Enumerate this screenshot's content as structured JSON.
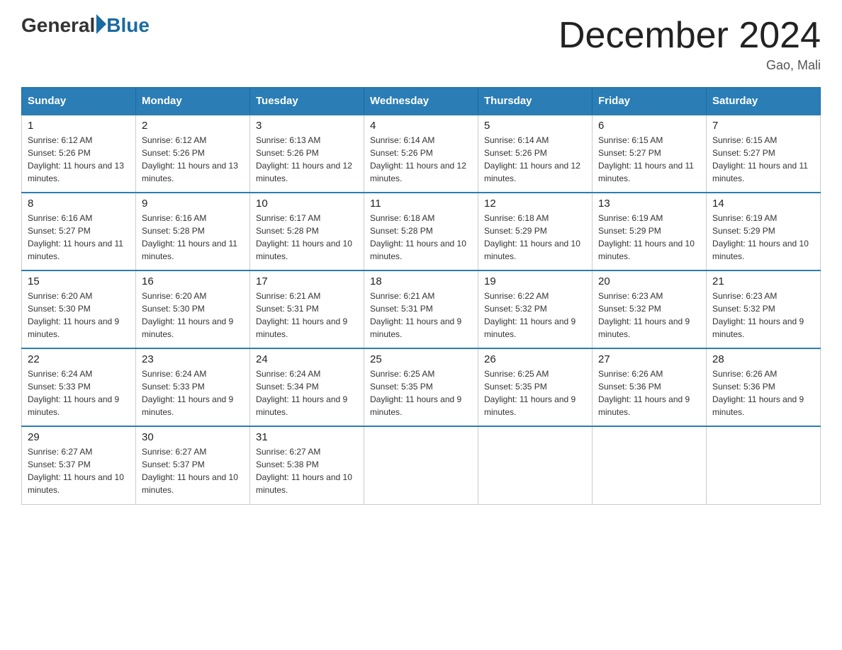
{
  "header": {
    "logo_general": "General",
    "logo_blue": "Blue",
    "title": "December 2024",
    "location": "Gao, Mali"
  },
  "days_of_week": [
    "Sunday",
    "Monday",
    "Tuesday",
    "Wednesday",
    "Thursday",
    "Friday",
    "Saturday"
  ],
  "weeks": [
    [
      {
        "day": "1",
        "sunrise": "6:12 AM",
        "sunset": "5:26 PM",
        "daylight": "11 hours and 13 minutes."
      },
      {
        "day": "2",
        "sunrise": "6:12 AM",
        "sunset": "5:26 PM",
        "daylight": "11 hours and 13 minutes."
      },
      {
        "day": "3",
        "sunrise": "6:13 AM",
        "sunset": "5:26 PM",
        "daylight": "11 hours and 12 minutes."
      },
      {
        "day": "4",
        "sunrise": "6:14 AM",
        "sunset": "5:26 PM",
        "daylight": "11 hours and 12 minutes."
      },
      {
        "day": "5",
        "sunrise": "6:14 AM",
        "sunset": "5:26 PM",
        "daylight": "11 hours and 12 minutes."
      },
      {
        "day": "6",
        "sunrise": "6:15 AM",
        "sunset": "5:27 PM",
        "daylight": "11 hours and 11 minutes."
      },
      {
        "day": "7",
        "sunrise": "6:15 AM",
        "sunset": "5:27 PM",
        "daylight": "11 hours and 11 minutes."
      }
    ],
    [
      {
        "day": "8",
        "sunrise": "6:16 AM",
        "sunset": "5:27 PM",
        "daylight": "11 hours and 11 minutes."
      },
      {
        "day": "9",
        "sunrise": "6:16 AM",
        "sunset": "5:28 PM",
        "daylight": "11 hours and 11 minutes."
      },
      {
        "day": "10",
        "sunrise": "6:17 AM",
        "sunset": "5:28 PM",
        "daylight": "11 hours and 10 minutes."
      },
      {
        "day": "11",
        "sunrise": "6:18 AM",
        "sunset": "5:28 PM",
        "daylight": "11 hours and 10 minutes."
      },
      {
        "day": "12",
        "sunrise": "6:18 AM",
        "sunset": "5:29 PM",
        "daylight": "11 hours and 10 minutes."
      },
      {
        "day": "13",
        "sunrise": "6:19 AM",
        "sunset": "5:29 PM",
        "daylight": "11 hours and 10 minutes."
      },
      {
        "day": "14",
        "sunrise": "6:19 AM",
        "sunset": "5:29 PM",
        "daylight": "11 hours and 10 minutes."
      }
    ],
    [
      {
        "day": "15",
        "sunrise": "6:20 AM",
        "sunset": "5:30 PM",
        "daylight": "11 hours and 9 minutes."
      },
      {
        "day": "16",
        "sunrise": "6:20 AM",
        "sunset": "5:30 PM",
        "daylight": "11 hours and 9 minutes."
      },
      {
        "day": "17",
        "sunrise": "6:21 AM",
        "sunset": "5:31 PM",
        "daylight": "11 hours and 9 minutes."
      },
      {
        "day": "18",
        "sunrise": "6:21 AM",
        "sunset": "5:31 PM",
        "daylight": "11 hours and 9 minutes."
      },
      {
        "day": "19",
        "sunrise": "6:22 AM",
        "sunset": "5:32 PM",
        "daylight": "11 hours and 9 minutes."
      },
      {
        "day": "20",
        "sunrise": "6:23 AM",
        "sunset": "5:32 PM",
        "daylight": "11 hours and 9 minutes."
      },
      {
        "day": "21",
        "sunrise": "6:23 AM",
        "sunset": "5:32 PM",
        "daylight": "11 hours and 9 minutes."
      }
    ],
    [
      {
        "day": "22",
        "sunrise": "6:24 AM",
        "sunset": "5:33 PM",
        "daylight": "11 hours and 9 minutes."
      },
      {
        "day": "23",
        "sunrise": "6:24 AM",
        "sunset": "5:33 PM",
        "daylight": "11 hours and 9 minutes."
      },
      {
        "day": "24",
        "sunrise": "6:24 AM",
        "sunset": "5:34 PM",
        "daylight": "11 hours and 9 minutes."
      },
      {
        "day": "25",
        "sunrise": "6:25 AM",
        "sunset": "5:35 PM",
        "daylight": "11 hours and 9 minutes."
      },
      {
        "day": "26",
        "sunrise": "6:25 AM",
        "sunset": "5:35 PM",
        "daylight": "11 hours and 9 minutes."
      },
      {
        "day": "27",
        "sunrise": "6:26 AM",
        "sunset": "5:36 PM",
        "daylight": "11 hours and 9 minutes."
      },
      {
        "day": "28",
        "sunrise": "6:26 AM",
        "sunset": "5:36 PM",
        "daylight": "11 hours and 9 minutes."
      }
    ],
    [
      {
        "day": "29",
        "sunrise": "6:27 AM",
        "sunset": "5:37 PM",
        "daylight": "11 hours and 10 minutes."
      },
      {
        "day": "30",
        "sunrise": "6:27 AM",
        "sunset": "5:37 PM",
        "daylight": "11 hours and 10 minutes."
      },
      {
        "day": "31",
        "sunrise": "6:27 AM",
        "sunset": "5:38 PM",
        "daylight": "11 hours and 10 minutes."
      },
      null,
      null,
      null,
      null
    ]
  ],
  "labels": {
    "sunrise": "Sunrise:",
    "sunset": "Sunset:",
    "daylight": "Daylight:"
  }
}
